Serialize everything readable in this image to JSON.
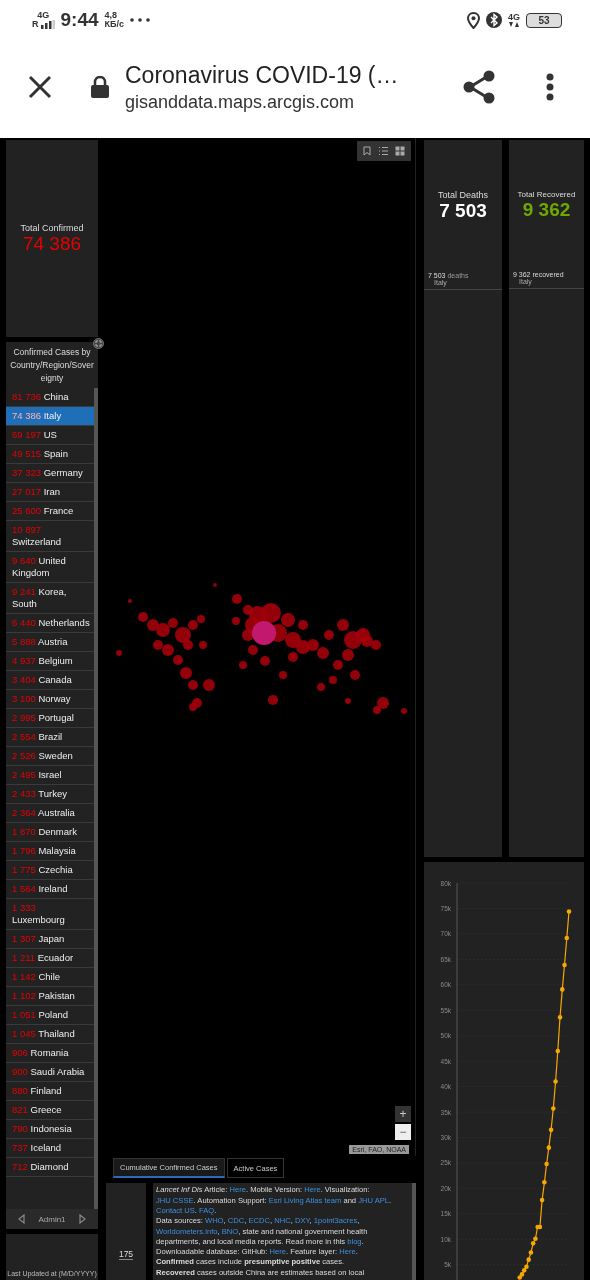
{
  "status_bar": {
    "network": "4G",
    "roaming": "R",
    "time": "9:44",
    "speed": "4,8",
    "speed_unit": "КБ/с",
    "network_right": "4G",
    "battery": "53"
  },
  "browser": {
    "title": "Coronavirus COVID-19 (…",
    "url": "gisanddata.maps.arcgis.com"
  },
  "total_confirmed": {
    "label": "Total Confirmed",
    "value": "74 386"
  },
  "country_list": {
    "title": "Confirmed Cases by Country/Region/Sovereignty",
    "rows": [
      {
        "count": "81 736",
        "name": "China",
        "selected": false
      },
      {
        "count": "74 386",
        "name": "Italy",
        "selected": true
      },
      {
        "count": "69 197",
        "name": "US",
        "selected": false
      },
      {
        "count": "49 515",
        "name": "Spain",
        "selected": false
      },
      {
        "count": "37 323",
        "name": "Germany",
        "selected": false
      },
      {
        "count": "27 017",
        "name": "Iran",
        "selected": false
      },
      {
        "count": "25 600",
        "name": "France",
        "selected": false
      },
      {
        "count": "10 897",
        "name": "Switzerland",
        "selected": false
      },
      {
        "count": "9 640",
        "name": "United Kingdom",
        "selected": false
      },
      {
        "count": "9 241",
        "name": "Korea, South",
        "selected": false
      },
      {
        "count": "6 440",
        "name": "Netherlands",
        "selected": false
      },
      {
        "count": "5 888",
        "name": "Austria",
        "selected": false
      },
      {
        "count": "4 937",
        "name": "Belgium",
        "selected": false
      },
      {
        "count": "3 404",
        "name": "Canada",
        "selected": false
      },
      {
        "count": "3 100",
        "name": "Norway",
        "selected": false
      },
      {
        "count": "2 995",
        "name": "Portugal",
        "selected": false
      },
      {
        "count": "2 554",
        "name": "Brazil",
        "selected": false
      },
      {
        "count": "2 526",
        "name": "Sweden",
        "selected": false
      },
      {
        "count": "2 495",
        "name": "Israel",
        "selected": false
      },
      {
        "count": "2 433",
        "name": "Turkey",
        "selected": false
      },
      {
        "count": "2 364",
        "name": "Australia",
        "selected": false
      },
      {
        "count": "1 870",
        "name": "Denmark",
        "selected": false
      },
      {
        "count": "1 796",
        "name": "Malaysia",
        "selected": false
      },
      {
        "count": "1 775",
        "name": "Czechia",
        "selected": false
      },
      {
        "count": "1 564",
        "name": "Ireland",
        "selected": false
      },
      {
        "count": "1 333",
        "name": "Luxembourg",
        "selected": false
      },
      {
        "count": "1 307",
        "name": "Japan",
        "selected": false
      },
      {
        "count": "1 211",
        "name": "Ecuador",
        "selected": false
      },
      {
        "count": "1 142",
        "name": "Chile",
        "selected": false
      },
      {
        "count": "1 102",
        "name": "Pakistan",
        "selected": false
      },
      {
        "count": "1 051",
        "name": "Poland",
        "selected": false
      },
      {
        "count": "1 045",
        "name": "Thailand",
        "selected": false
      },
      {
        "count": "906",
        "name": "Romania",
        "selected": false
      },
      {
        "count": "900",
        "name": "Saudi Arabia",
        "selected": false
      },
      {
        "count": "880",
        "name": "Finland",
        "selected": false
      },
      {
        "count": "821",
        "name": "Greece",
        "selected": false
      },
      {
        "count": "790",
        "name": "Indonesia",
        "selected": false
      },
      {
        "count": "737",
        "name": "Iceland",
        "selected": false
      },
      {
        "count": "712",
        "name": "Diamond",
        "selected": false
      }
    ],
    "pager": {
      "label": "Admin1"
    }
  },
  "last_updated": "Last Updated at (M/D/YYYY)",
  "map": {
    "attribution": "Esri, FAO, NOAA",
    "zoom_in": "+",
    "zoom_out": "−"
  },
  "map_tabs": [
    {
      "label": "Cumulative Confirmed Cases",
      "selected": true
    },
    {
      "label": "Active Cases",
      "selected": false
    }
  ],
  "count": "175",
  "info": [
    [
      {
        "kind": "italic",
        "text": "Lancet Inf Dis"
      },
      {
        "kind": "text",
        "text": " Article: "
      },
      {
        "kind": "link",
        "text": "Here"
      },
      {
        "kind": "text",
        "text": ". Mobile Version: "
      },
      {
        "kind": "link",
        "text": "Here"
      },
      {
        "kind": "text",
        "text": ". Visualization: "
      },
      {
        "kind": "link",
        "text": "JHU CSSE"
      },
      {
        "kind": "text",
        "text": ". Automation Support: "
      },
      {
        "kind": "link",
        "text": "Esri Living Atlas team"
      },
      {
        "kind": "text",
        "text": " and "
      },
      {
        "kind": "link",
        "text": "JHU APL"
      },
      {
        "kind": "text",
        "text": ". "
      },
      {
        "kind": "link",
        "text": "Contact US"
      },
      {
        "kind": "text",
        "text": ". "
      },
      {
        "kind": "link",
        "text": "FAQ"
      },
      {
        "kind": "text",
        "text": "."
      }
    ],
    [
      {
        "kind": "text",
        "text": "Data sources: "
      },
      {
        "kind": "link",
        "text": "WHO"
      },
      {
        "kind": "text",
        "text": ", "
      },
      {
        "kind": "link",
        "text": "CDC"
      },
      {
        "kind": "text",
        "text": ", "
      },
      {
        "kind": "link",
        "text": "ECDC"
      },
      {
        "kind": "text",
        "text": ", "
      },
      {
        "kind": "link",
        "text": "NHC"
      },
      {
        "kind": "text",
        "text": ", "
      },
      {
        "kind": "link",
        "text": "DXY"
      },
      {
        "kind": "text",
        "text": ", "
      },
      {
        "kind": "link",
        "text": "1point3acres"
      },
      {
        "kind": "text",
        "text": ", "
      },
      {
        "kind": "link",
        "text": "Worldometers.info"
      },
      {
        "kind": "text",
        "text": ", "
      },
      {
        "kind": "link",
        "text": "BNO"
      },
      {
        "kind": "text",
        "text": ", state and national government health departments, and local media reports.  Read more in this "
      },
      {
        "kind": "link",
        "text": "blog"
      },
      {
        "kind": "text",
        "text": "."
      }
    ],
    [
      {
        "kind": "text",
        "text": "Downloadable database: GitHub: "
      },
      {
        "kind": "link",
        "text": "Here"
      },
      {
        "kind": "text",
        "text": ". Feature layer: "
      },
      {
        "kind": "link",
        "text": "Here"
      },
      {
        "kind": "text",
        "text": "."
      }
    ],
    [
      {
        "kind": "bold",
        "text": "Confirmed"
      },
      {
        "kind": "text",
        "text": " cases include "
      },
      {
        "kind": "bold",
        "text": "presumptive positive"
      },
      {
        "kind": "text",
        "text": " cases."
      }
    ],
    [
      {
        "kind": "bold",
        "text": "Recovered"
      },
      {
        "kind": "text",
        "text": " cases outside China are estimates based on local"
      }
    ]
  ],
  "total_deaths": {
    "label": "Total Deaths",
    "value": "7 503",
    "detail": {
      "value": "7 503",
      "unit": "deaths",
      "place": "Italy"
    }
  },
  "total_recovered": {
    "label": "Total Recovered",
    "value": "9 362",
    "detail": {
      "value": "9 362",
      "unit": "recovered",
      "place": "Italy"
    }
  },
  "chart": {
    "chart_data": {
      "type": "line",
      "grid": true,
      "ylim": [
        2000,
        80000
      ],
      "categories": [
        null,
        null,
        null,
        null,
        null,
        null,
        null,
        null,
        null,
        null,
        null,
        null,
        null,
        null,
        null,
        null,
        null,
        null,
        null,
        null,
        null,
        null,
        null,
        null,
        null,
        null,
        null,
        null,
        null,
        null,
        null,
        null,
        null,
        null,
        null,
        null,
        null,
        null,
        null,
        null,
        null,
        null,
        null,
        null,
        null,
        null,
        null,
        null,
        null,
        null,
        null
      ],
      "yticks": [
        {
          "value": 5000,
          "label": "5k"
        },
        {
          "value": 10000,
          "label": "10k"
        },
        {
          "value": 15000,
          "label": "15k"
        },
        {
          "value": 20000,
          "label": "20k"
        },
        {
          "value": 25000,
          "label": "25k"
        },
        {
          "value": 30000,
          "label": "30k"
        },
        {
          "value": 35000,
          "label": "35k"
        },
        {
          "value": 40000,
          "label": "40k"
        },
        {
          "value": 45000,
          "label": "45k"
        },
        {
          "value": 50000,
          "label": "50k"
        },
        {
          "value": 55000,
          "label": "55k"
        },
        {
          "value": 60000,
          "label": "60k"
        },
        {
          "value": 65000,
          "label": "65k"
        },
        {
          "value": 70000,
          "label": "70k"
        },
        {
          "value": 75000,
          "label": "75k"
        },
        {
          "value": 80000,
          "label": "80k"
        }
      ],
      "series": [
        {
          "color": "#f5a800",
          "values": [
            null,
            null,
            null,
            null,
            null,
            null,
            null,
            null,
            null,
            null,
            null,
            null,
            null,
            null,
            null,
            null,
            null,
            null,
            null,
            null,
            null,
            null,
            null,
            null,
            null,
            null,
            null,
            null,
            2500,
            3100,
            3900,
            4600,
            6000,
            7400,
            9200,
            10100,
            12400,
            12400,
            17700,
            21200,
            24800,
            28000,
            31500,
            35700,
            41000,
            47000,
            53600,
            59100,
            63900,
            69200,
            74400
          ]
        }
      ]
    }
  }
}
